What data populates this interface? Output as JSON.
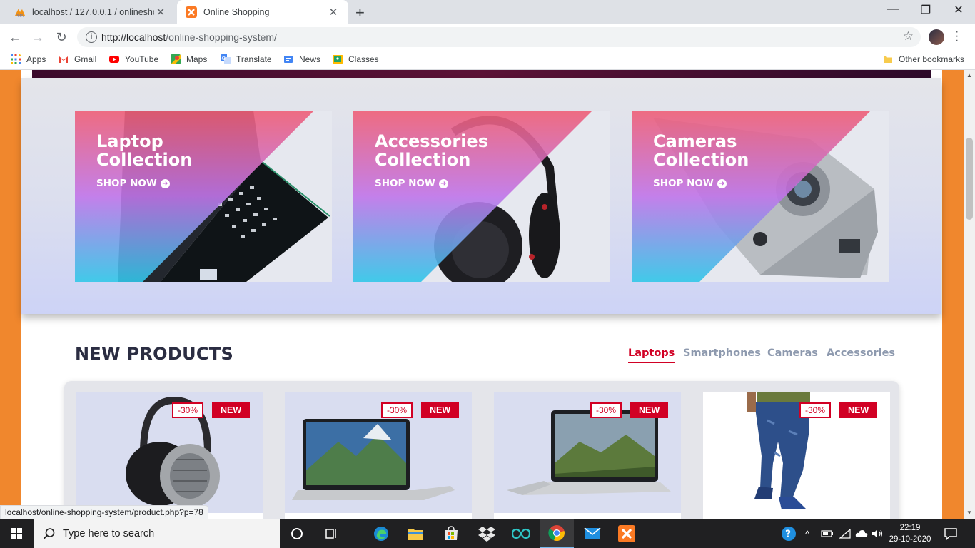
{
  "browser": {
    "tabs": [
      {
        "title": "localhost / 127.0.0.1 / onlineshop",
        "favicon": "phpmyadmin-icon"
      },
      {
        "title": "Online Shopping",
        "favicon": "xampp-icon"
      }
    ],
    "url_host": "http://localhost",
    "url_path": "/online-shopping-system/",
    "bookmarks": [
      "Apps",
      "Gmail",
      "YouTube",
      "Maps",
      "Translate",
      "News",
      "Classes"
    ],
    "other_bookmarks": "Other bookmarks"
  },
  "collections": [
    {
      "line1": "Laptop",
      "line2": "Collection",
      "cta": "SHOP NOW",
      "image": "laptop"
    },
    {
      "line1": "Accessories",
      "line2": "Collection",
      "cta": "SHOP NOW",
      "image": "headphones"
    },
    {
      "line1": "Cameras",
      "line2": "Collection",
      "cta": "SHOP NOW",
      "image": "camera"
    }
  ],
  "new_products": {
    "title": "NEW PRODUCTS",
    "tabs": [
      {
        "label": "Laptops",
        "active": true
      },
      {
        "label": "Smartphones",
        "active": false
      },
      {
        "label": "Cameras",
        "active": false
      },
      {
        "label": "Accessories",
        "active": false
      }
    ],
    "items": [
      {
        "sale": "-30%",
        "badge": "NEW",
        "image": "headphones"
      },
      {
        "sale": "-30%",
        "badge": "NEW",
        "image": "laptop"
      },
      {
        "sale": "-30%",
        "badge": "NEW",
        "image": "laptop"
      },
      {
        "sale": "-30%",
        "badge": "NEW",
        "image": "jeans"
      }
    ]
  },
  "status_url": "localhost/online-shopping-system/product.php?p=78",
  "taskbar": {
    "search_placeholder": "Type here to search",
    "time": "22:19",
    "date": "29-10-2020"
  },
  "colors": {
    "brand_red": "#d10024",
    "page_orange": "#f0872d",
    "title_dark": "#2b2d42",
    "muted_tab": "#8d99ae"
  }
}
